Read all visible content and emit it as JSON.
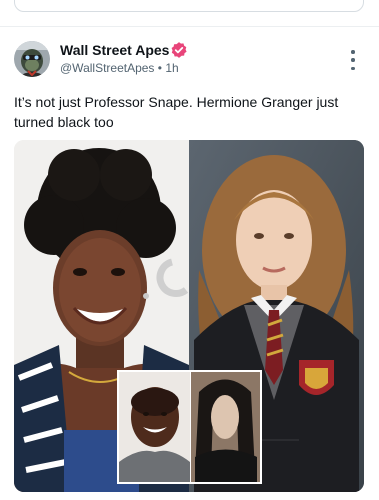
{
  "post": {
    "author_name": "Wall Street Apes",
    "handle": "@WallStreetApes",
    "separator": "•",
    "time": "1h",
    "text": "It’s not just Professor Snape. Hermione Granger just turned black too"
  },
  "colors": {
    "verified_badge": "#e8457a",
    "name_text": "#0f1419",
    "secondary_text": "#536471"
  },
  "icons": {
    "verified": "verified-badge-icon",
    "more": "more-options-icon"
  }
}
